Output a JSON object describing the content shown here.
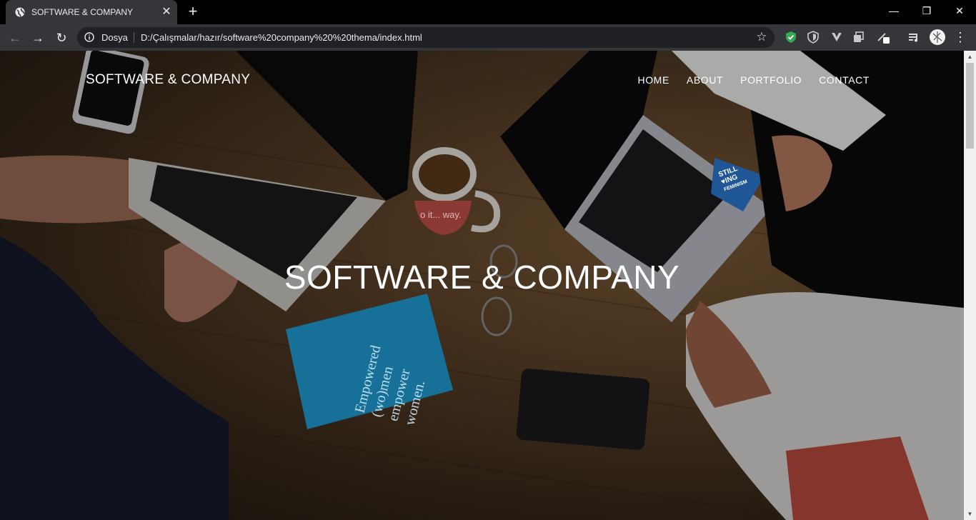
{
  "browser": {
    "tab_title": "SOFTWARE & COMPANY",
    "tab_close": "✕",
    "new_tab": "+",
    "window": {
      "minimize": "—",
      "restore": "❐",
      "close": "✕"
    },
    "address": {
      "origin_label": "Dosya",
      "url": "D:/Çalışmalar/hazır/software%20company%20%20thema/index.html"
    },
    "icons": [
      "back-arrow-icon",
      "forward-arrow-icon",
      "reload-icon",
      "info-icon",
      "star-icon",
      "menu-dots-icon"
    ],
    "colors": {
      "chrome_bg": "#35363a",
      "tabbar_bg": "#000000",
      "omnibox_bg": "#202124",
      "shield_green": "#34a853"
    }
  },
  "page": {
    "brand": "SOFTWARE & COMPANY",
    "nav": {
      "home": "HOME",
      "about": "ABOUT",
      "portfolio": "PORTFOLIO",
      "contact": "CONTACT"
    },
    "hero_title": "SOFTWARE & COMPANY",
    "book_text": [
      "Empowered",
      "(wo)men",
      "empower",
      "women."
    ],
    "sticker_text": [
      "STILL",
      "♥ING",
      "FEMINISM"
    ],
    "mug_text": "o it... way."
  }
}
